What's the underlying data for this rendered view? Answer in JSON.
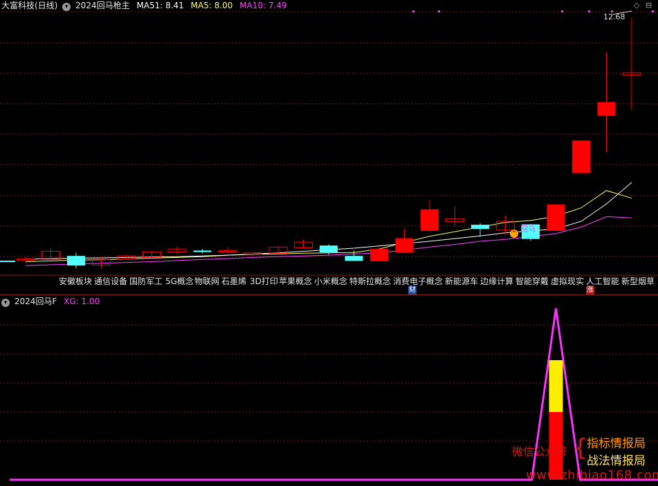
{
  "header": {
    "stock": "大富科技(日线)",
    "indicator": "2024回马枪主",
    "ma_items": [
      {
        "label": "MA51: 8.41",
        "color": "#ffffff"
      },
      {
        "label": "MA5: 8.00",
        "color": "#ffff66"
      },
      {
        "label": "MA10: 7.49",
        "color": "#ff44ff"
      }
    ]
  },
  "price_label": "12.68",
  "signal_text": "回马",
  "concepts": [
    "安徽板块",
    "通信设备",
    "国防军工",
    "5G概念",
    "物联网",
    "石墨烯",
    "3D打印",
    "苹果概念",
    "小米概念",
    "特斯拉概念",
    "消费电子概念",
    "新能源车",
    "边缘计算",
    "智能穿戴",
    "虚拟现实",
    "人工智能",
    "新型烟草"
  ],
  "tags": {
    "cai": "财",
    "zhang": "涨"
  },
  "indicator_panel": {
    "name": "2024回马F",
    "value_label": "XG: 1.00"
  },
  "watermark": {
    "left": "微信公众号",
    "brace": "{",
    "right1": "指标情报局",
    "right2": "战法情报局",
    "url": "www.zhibiao168.com"
  },
  "colors": {
    "up": "#ff0000",
    "down": "#54ffff",
    "grid": "#8a1d1d",
    "ma51": "#ffffff",
    "ma5": "#ffff66",
    "ma10": "#ff44ff",
    "signal": "#ff33ff"
  },
  "candles": [
    {
      "o": 6.38,
      "h": 6.47,
      "l": 6.32,
      "c": 6.42
    },
    {
      "o": 6.41,
      "h": 6.7,
      "l": 6.38,
      "c": 6.62
    },
    {
      "o": 6.5,
      "h": 6.58,
      "l": 6.18,
      "c": 6.25
    },
    {
      "o": 6.26,
      "h": 6.46,
      "l": 6.19,
      "c": 6.41
    },
    {
      "o": 6.42,
      "h": 6.54,
      "l": 6.4,
      "c": 6.5
    },
    {
      "o": 6.46,
      "h": 6.63,
      "l": 6.43,
      "c": 6.6
    },
    {
      "o": 6.6,
      "h": 6.74,
      "l": 6.56,
      "c": 6.68
    },
    {
      "o": 6.64,
      "h": 6.68,
      "l": 6.57,
      "c": 6.6
    },
    {
      "o": 6.6,
      "h": 6.72,
      "l": 6.58,
      "c": 6.64
    },
    {
      "o": 6.55,
      "h": 6.6,
      "l": 6.49,
      "c": 6.58
    },
    {
      "o": 6.57,
      "h": 6.75,
      "l": 6.53,
      "c": 6.73
    },
    {
      "o": 6.71,
      "h": 6.92,
      "l": 6.69,
      "c": 6.86
    },
    {
      "o": 6.77,
      "h": 6.8,
      "l": 6.53,
      "c": 6.59
    },
    {
      "o": 6.5,
      "h": 6.64,
      "l": 6.39,
      "c": 6.37
    },
    {
      "o": 6.36,
      "h": 6.73,
      "l": 6.36,
      "c": 6.68
    },
    {
      "o": 6.58,
      "h": 7.21,
      "l": 6.58,
      "c": 6.96
    },
    {
      "o": 7.15,
      "h": 7.94,
      "l": 7.11,
      "c": 7.71
    },
    {
      "o": 7.39,
      "h": 7.79,
      "l": 7.29,
      "c": 7.47
    },
    {
      "o": 7.31,
      "h": 7.35,
      "l": 7.0,
      "c": 7.2
    },
    {
      "o": 7.17,
      "h": 7.55,
      "l": 7.05,
      "c": 7.4
    },
    {
      "o": 7.32,
      "h": 7.33,
      "l": 6.89,
      "c": 6.94
    },
    {
      "o": 7.15,
      "h": 7.84,
      "l": 7.15,
      "c": 7.84
    },
    {
      "o": 8.65,
      "h": 9.5,
      "l": 8.65,
      "c": 9.5
    },
    {
      "o": 10.14,
      "h": 11.8,
      "l": 9.2,
      "c": 10.5
    },
    {
      "o": 11.2,
      "h": 12.68,
      "l": 10.3,
      "c": 11.26
    }
  ],
  "ma51": [
    6.42,
    6.43,
    6.44,
    6.45,
    6.46,
    6.47,
    6.48,
    6.5,
    6.52,
    6.55,
    6.58,
    6.62,
    6.66,
    6.7,
    6.76,
    6.82,
    6.88,
    6.95,
    7.02,
    7.1,
    7.15,
    7.2,
    7.4,
    7.85,
    8.41
  ],
  "ma5": [
    6.35,
    6.37,
    6.39,
    6.4,
    6.42,
    6.44,
    6.46,
    6.48,
    6.52,
    6.54,
    6.55,
    6.57,
    6.58,
    6.59,
    6.68,
    6.85,
    7.01,
    7.13,
    7.25,
    7.37,
    7.42,
    7.53,
    7.75,
    8.2,
    8.0
  ],
  "ma10": [
    6.25,
    6.27,
    6.29,
    6.31,
    6.33,
    6.35,
    6.38,
    6.41,
    6.43,
    6.46,
    6.48,
    6.5,
    6.52,
    6.55,
    6.58,
    6.65,
    6.73,
    6.8,
    6.88,
    6.93,
    7.0,
    7.08,
    7.25,
    7.52,
    7.49
  ],
  "xg": [
    0,
    0,
    0,
    0,
    0,
    0,
    0,
    0,
    0,
    0,
    0,
    0,
    0,
    0,
    0,
    0,
    0,
    0,
    0,
    0,
    0,
    1,
    0,
    0,
    0
  ]
}
